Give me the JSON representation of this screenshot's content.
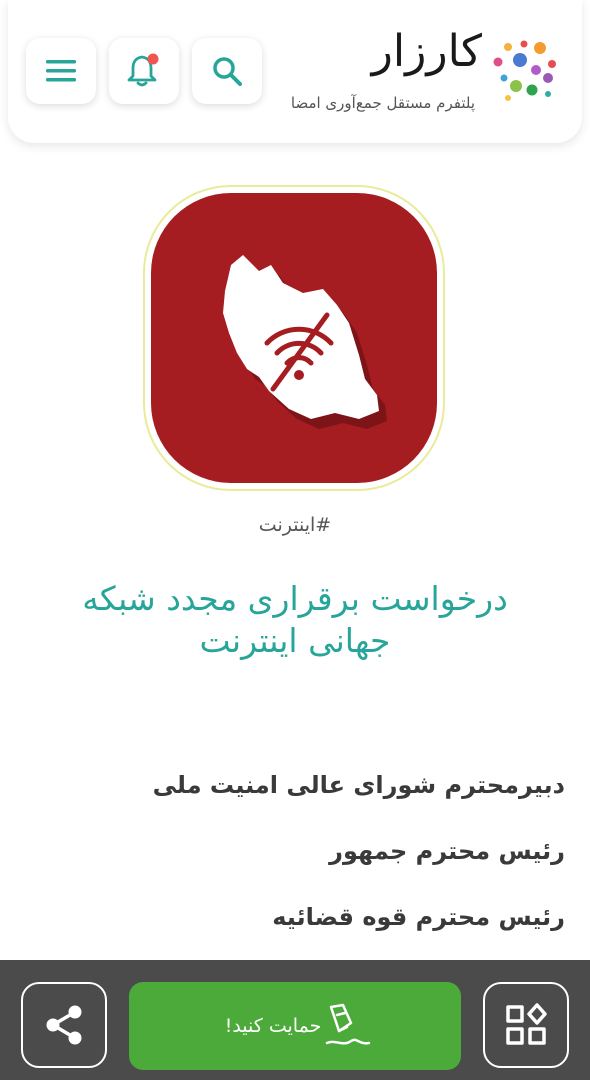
{
  "header": {
    "brand_name": "کارزار",
    "brand_tagline": "پلتفرم مستقل جمع‌آوری امضا",
    "notification_dot_color": "#f0564f",
    "icon_color": "#27a59a"
  },
  "petition": {
    "hashtag": "#اینترنت",
    "title": "درخواست برقراری مجدد شبکه جهانی اینترنت",
    "recipients": [
      "دبیرمحترم شورای عالی امنیت ملی",
      "رئیس محترم جمهور",
      "رئیس محترم قوه قضائیه"
    ]
  },
  "actions": {
    "support_label": "حمایت کنید!",
    "share_icon": "share-icon",
    "categories_icon": "categories-icon",
    "support_color": "#4caa3b"
  },
  "colors": {
    "accent": "#27a59a",
    "image_bg": "#a51d21",
    "bottom_bar": "#4b4b4b"
  }
}
